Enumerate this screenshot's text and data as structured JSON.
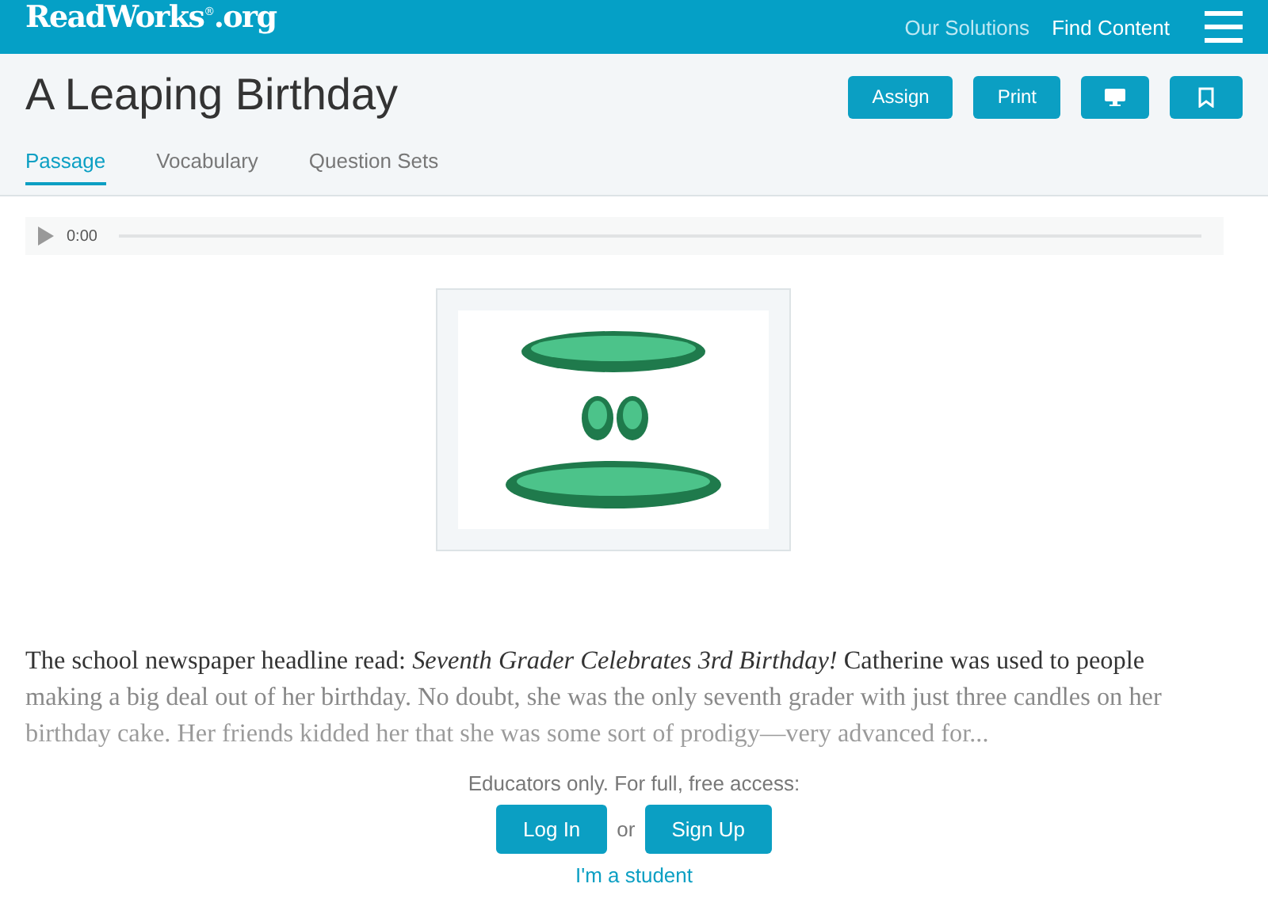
{
  "header": {
    "logo": "ReadWorks$^{®}$.org",
    "nav": [
      {
        "label": "Our Solutions",
        "selected": false
      },
      {
        "label": "Find Content",
        "selected": true
      }
    ]
  },
  "title": "A Leaping Birthday",
  "actions": [
    {
      "kind": "text",
      "label": "Assign"
    },
    {
      "kind": "text",
      "label": "Print"
    },
    {
      "kind": "monitor"
    },
    {
      "kind": "bookmark"
    }
  ],
  "tabs": [
    {
      "label": "Passage",
      "selected": true
    },
    {
      "label": "Vocabulary",
      "selected": false
    },
    {
      "label": "Question Sets",
      "selected": false
    }
  ],
  "audio": {
    "time": "0:00"
  },
  "passage": "The school newspaper headline read: *Seventh Grader Celebrates 3rd Birthday!* Catherine was used to people making a big deal out of her birthday. No doubt, she was the only seventh grader with just three candles on her birthday cake. Her friends kidded her that she was some sort of prodigy—very advanced for...",
  "access": {
    "note": "Educators only. For full, free access:",
    "login": "Log In",
    "or": "or",
    "signup": "Sign Up",
    "student": "I'm a student"
  }
}
